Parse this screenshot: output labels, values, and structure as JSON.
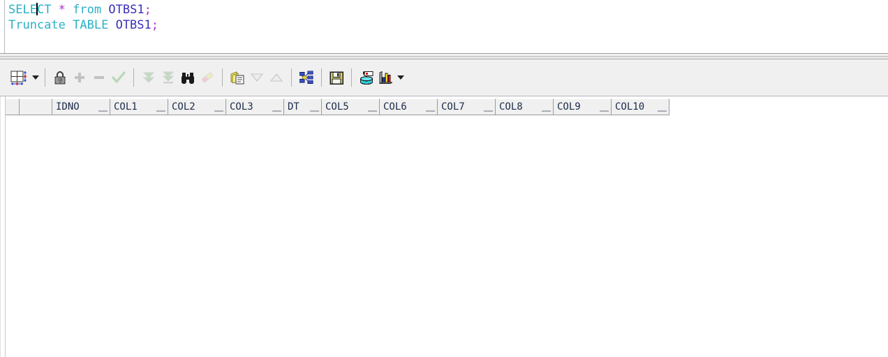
{
  "editor": {
    "lines": [
      {
        "tokens": [
          {
            "text": "SELE",
            "type": "keyword"
          },
          {
            "text": "",
            "type": "caret"
          },
          {
            "text": "CT ",
            "type": "keyword"
          },
          {
            "text": "*",
            "type": "star"
          },
          {
            "text": " ",
            "type": "plain"
          },
          {
            "text": "from",
            "type": "keyword"
          },
          {
            "text": " ",
            "type": "plain"
          },
          {
            "text": "OTBS1",
            "type": "identifier"
          },
          {
            "text": ";",
            "type": "punct"
          }
        ],
        "plain": "SELECT * from OTBS1;"
      },
      {
        "tokens": [
          {
            "text": "Truncate",
            "type": "keyword"
          },
          {
            "text": " ",
            "type": "plain"
          },
          {
            "text": "TABLE",
            "type": "keyword"
          },
          {
            "text": " ",
            "type": "plain"
          },
          {
            "text": "OTBS1",
            "type": "identifier"
          },
          {
            "text": ";",
            "type": "punct"
          }
        ],
        "plain": "Truncate TABLE OTBS1;"
      }
    ],
    "colors": {
      "keyword": "#2ab0c5",
      "star": "#b030d0",
      "identifier": "#3b2fb8",
      "punct": "#b030d0",
      "caret": "#000000",
      "background": "#ffffff"
    }
  },
  "toolbar": {
    "background": "#f0f0f0",
    "items": [
      {
        "name": "grid-layout-icon",
        "title": "Grid / Single record layout",
        "enabled": true,
        "type": "icon"
      },
      {
        "name": "layout-dropdown-arrow",
        "title": "Layout options",
        "enabled": true,
        "type": "caret"
      },
      {
        "name": "separator",
        "title": "",
        "enabled": false,
        "type": "separator"
      },
      {
        "name": "lock-icon",
        "title": "Freeze / lock record",
        "enabled": true,
        "type": "icon"
      },
      {
        "name": "plus-icon",
        "title": "Insert record",
        "enabled": false,
        "type": "icon"
      },
      {
        "name": "minus-icon",
        "title": "Delete record",
        "enabled": false,
        "type": "icon"
      },
      {
        "name": "checkmark-icon",
        "title": "Post / commit edit",
        "enabled": false,
        "type": "icon"
      },
      {
        "name": "separator",
        "title": "",
        "enabled": false,
        "type": "separator"
      },
      {
        "name": "fetch-next-icon",
        "title": "Fetch next rows",
        "enabled": false,
        "type": "icon"
      },
      {
        "name": "fetch-all-icon",
        "title": "Fetch all rows",
        "enabled": false,
        "type": "icon"
      },
      {
        "name": "binoculars-icon",
        "title": "Find",
        "enabled": true,
        "type": "icon"
      },
      {
        "name": "eraser-icon",
        "title": "Clear filter",
        "enabled": false,
        "type": "icon"
      },
      {
        "name": "separator",
        "title": "",
        "enabled": false,
        "type": "separator"
      },
      {
        "name": "copy-to-clipboard-icon",
        "title": "Copy data",
        "enabled": true,
        "type": "icon"
      },
      {
        "name": "sort-descending-icon",
        "title": "Sort descending",
        "enabled": false,
        "type": "icon"
      },
      {
        "name": "sort-ascending-icon",
        "title": "Sort ascending",
        "enabled": false,
        "type": "icon"
      },
      {
        "name": "separator",
        "title": "",
        "enabled": false,
        "type": "separator"
      },
      {
        "name": "master-detail-icon",
        "title": "Master / detail view",
        "enabled": true,
        "type": "icon"
      },
      {
        "name": "separator",
        "title": "",
        "enabled": false,
        "type": "separator"
      },
      {
        "name": "save-floppy-icon",
        "title": "Export / save data",
        "enabled": true,
        "type": "icon"
      },
      {
        "name": "separator",
        "title": "",
        "enabled": false,
        "type": "separator"
      },
      {
        "name": "database-export-icon",
        "title": "Send to database",
        "enabled": true,
        "type": "icon"
      },
      {
        "name": "bar-chart-icon",
        "title": "Chart data",
        "enabled": true,
        "type": "icon"
      },
      {
        "name": "chart-dropdown-arrow",
        "title": "Chart options",
        "enabled": true,
        "type": "caret"
      }
    ]
  },
  "grid": {
    "row_count": 0,
    "background": "#ffffff",
    "header_background": "#f0f0f0",
    "header_text_color": "#1b2a4a",
    "indicator_columns": [
      {
        "name": "row-indicator-column",
        "width": 20
      },
      {
        "name": "row-select-column",
        "width": 47
      }
    ],
    "columns": [
      {
        "label": "IDNO",
        "width": 83
      },
      {
        "label": "COL1",
        "width": 83
      },
      {
        "label": "COL2",
        "width": 83
      },
      {
        "label": "COL3",
        "width": 83
      },
      {
        "label": "DT",
        "width": 54
      },
      {
        "label": "COL5",
        "width": 83
      },
      {
        "label": "COL6",
        "width": 83
      },
      {
        "label": "COL7",
        "width": 83
      },
      {
        "label": "COL8",
        "width": 83
      },
      {
        "label": "COL9",
        "width": 83
      },
      {
        "label": "COL10",
        "width": 83
      }
    ],
    "rows": []
  }
}
